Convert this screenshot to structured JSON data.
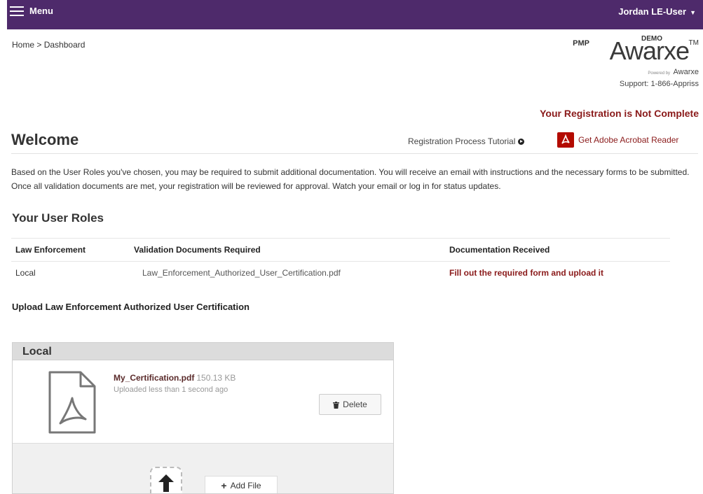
{
  "topbar": {
    "menu_label": "Menu",
    "user_name": "Jordan LE-User",
    "bg_color": "#4e2a6b"
  },
  "breadcrumb": {
    "home": "Home",
    "separator": ">",
    "current": "Dashboard"
  },
  "logo": {
    "pmp": "PMP",
    "demo": "DEMO",
    "brand": "Awarxe",
    "tm": "TM",
    "powered_by": "Powered by",
    "powered_brand": "Awarxe"
  },
  "support": "Support: 1-866-Appriss",
  "registration_warning": "Your Registration is Not Complete",
  "page_title": "Welcome",
  "tutorial_link": "Registration Process Tutorial",
  "acrobat_link": "Get Adobe Acrobat Reader",
  "intro_text": "Based on the User Roles you've chosen, you may be required to submit additional documentation. You will receive an email with instructions and the necessary forms to be submitted. Once all validation documents are met, your registration will be reviewed for approval. Watch your email or log in for status updates.",
  "roles": {
    "title": "Your User Roles",
    "headers": [
      "Law Enforcement",
      "Validation Documents Required",
      "Documentation Received"
    ],
    "rows": [
      {
        "role": "Local",
        "document": "Law_Enforcement_Authorized_User_Certification.pdf",
        "status": "Fill out the required form and upload it"
      }
    ]
  },
  "upload": {
    "title": "Upload Law Enforcement Authorized User Certification",
    "panel_title": "Local",
    "file": {
      "name": "My_Certification.pdf",
      "size": "150.13 KB",
      "uploaded": "Uploaded less than 1 second ago"
    },
    "delete_label": "Delete",
    "add_file_label": "Add File"
  },
  "colors": {
    "accent_red": "#8a1a1a",
    "acrobat_red": "#b30b00"
  },
  "icons": [
    "menu-icon",
    "caret-down-icon",
    "play-circle-icon",
    "acrobat-icon",
    "pdf-file-icon",
    "trash-icon",
    "upload-arrow-icon",
    "plus-icon"
  ]
}
